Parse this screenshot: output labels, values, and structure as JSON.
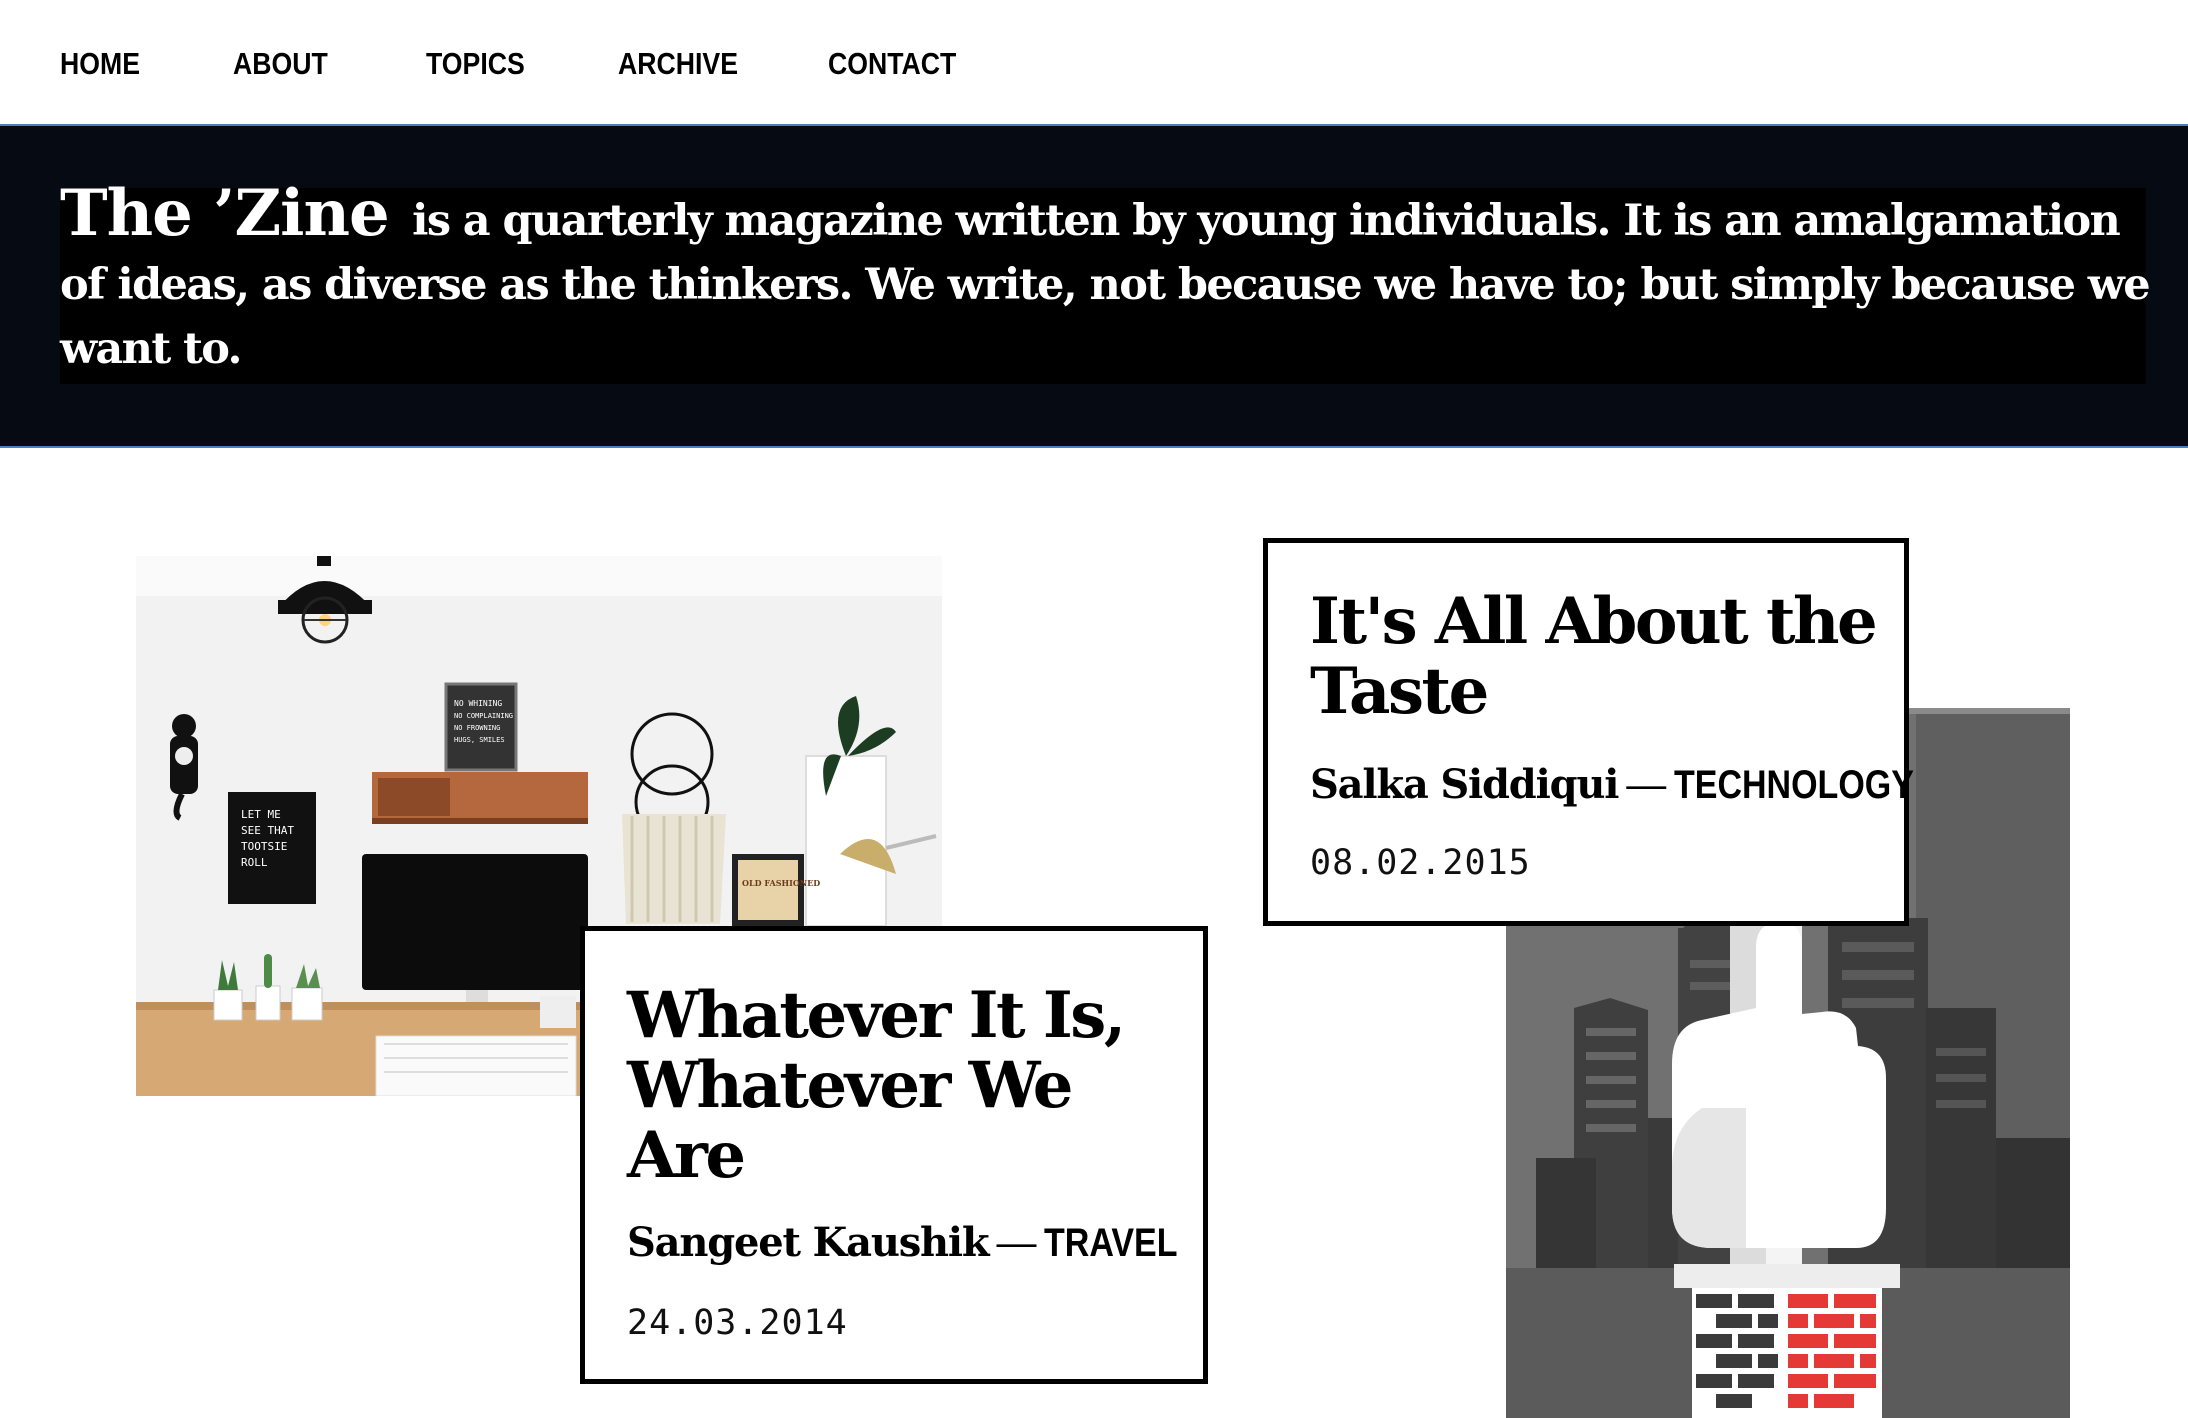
{
  "nav": {
    "items": [
      {
        "label": "HOME"
      },
      {
        "label": "ABOUT"
      },
      {
        "label": "TOPICS"
      },
      {
        "label": "ARCHIVE"
      },
      {
        "label": "CONTACT"
      }
    ]
  },
  "hero": {
    "brand": "The ’Zine",
    "tagline": "is a quarterly magazine written by young individuals. It is an amalgamation of ideas, as diverse as the thinkers. We write, not because we have to; but simply because we want to."
  },
  "articles": [
    {
      "title": "Whatever It Is, Whatever We Are",
      "author": "Sangeet Kaushik",
      "separator": "—",
      "topic": "TRAVEL",
      "date": "24.03.2014",
      "image_icon": "desk-workspace-photo"
    },
    {
      "title": "It's All About the Taste",
      "author": "Salka Siddiqui",
      "separator": "—",
      "topic": "TECHNOLOGY",
      "date": "08.02.2015",
      "image_icon": "city-hand-chimney-illustration"
    }
  ],
  "photo_text": {
    "letter_board": "LET ME SEE THAT TOOTSIE ROLL",
    "poster": "NO WHINING NO COMPLAINING NO FROWNING HUGS, SMILES",
    "sign": "OLD FASHIONED"
  },
  "colors": {
    "hero_bg": "#060b13",
    "hero_border": "#4a7fc0",
    "chimney_red": "#e53935"
  }
}
